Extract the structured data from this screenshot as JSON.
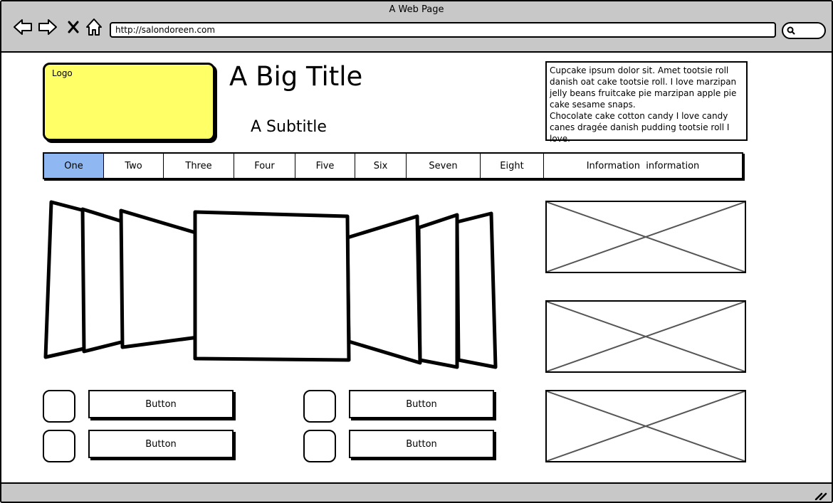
{
  "window": {
    "title": "A Web Page"
  },
  "toolbar": {
    "back_icon": "back-arrow-icon",
    "forward_icon": "forward-arrow-icon",
    "stop_icon": "close-icon",
    "home_icon": "home-icon",
    "url": "http://salondoreen.com",
    "search_icon": "search-icon"
  },
  "header": {
    "logo_label": "Logo",
    "title": "A Big Title",
    "subtitle": "A Subtitle",
    "description": [
      "Cupcake ipsum dolor sit. Amet tootsie roll danish oat cake tootsie roll. I love marzipan jelly beans fruitcake pie marzipan apple pie cake sesame snaps.",
      "Chocolate cake cotton candy I love candy canes dragée danish pudding tootsie roll I love."
    ]
  },
  "tabs": [
    {
      "label": "One",
      "active": true
    },
    {
      "label": "Two"
    },
    {
      "label": "Three"
    },
    {
      "label": "Four"
    },
    {
      "label": "Five"
    },
    {
      "label": "Six"
    },
    {
      "label": "Seven"
    },
    {
      "label": "Eight"
    },
    {
      "label": "Information  information"
    }
  ],
  "buttons": [
    {
      "label": "Button"
    },
    {
      "label": "Button"
    },
    {
      "label": "Button"
    },
    {
      "label": "Button"
    }
  ],
  "colors": {
    "logo_bg": "#ffff66",
    "active_tab": "#8fb7f2",
    "chrome": "#c8c8c8"
  }
}
